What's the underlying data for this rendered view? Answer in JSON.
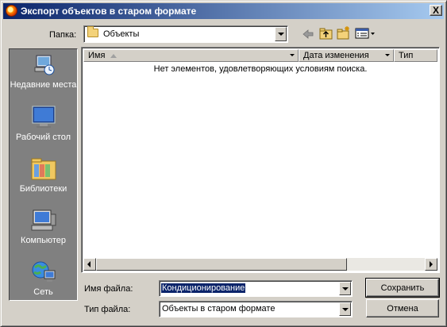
{
  "window": {
    "title": "Экспорт объектов в старом формате",
    "close_glyph": "X"
  },
  "lookin": {
    "label": "Папка:",
    "value": "Объекты"
  },
  "toolbar": {
    "icons": [
      "back-arrow-icon",
      "up-folder-icon",
      "new-folder-icon",
      "view-menu-icon"
    ]
  },
  "places": [
    {
      "label": "Недавние места",
      "icon": "recent-places-icon"
    },
    {
      "label": "Рабочий стол",
      "icon": "desktop-icon"
    },
    {
      "label": "Библиотеки",
      "icon": "libraries-icon"
    },
    {
      "label": "Компьютер",
      "icon": "computer-icon"
    },
    {
      "label": "Сеть",
      "icon": "network-icon"
    }
  ],
  "file_list": {
    "columns": [
      "Имя",
      "Дата изменения",
      "Тип"
    ],
    "empty_message": "Нет элементов, удовлетворяющих условиям поиска."
  },
  "filename": {
    "label": "Имя файла:",
    "value": "Кондиционирование"
  },
  "filetype": {
    "label": "Тип файла:",
    "value": "Объекты в старом формате"
  },
  "buttons": {
    "save": "Сохранить",
    "cancel": "Отмена"
  }
}
